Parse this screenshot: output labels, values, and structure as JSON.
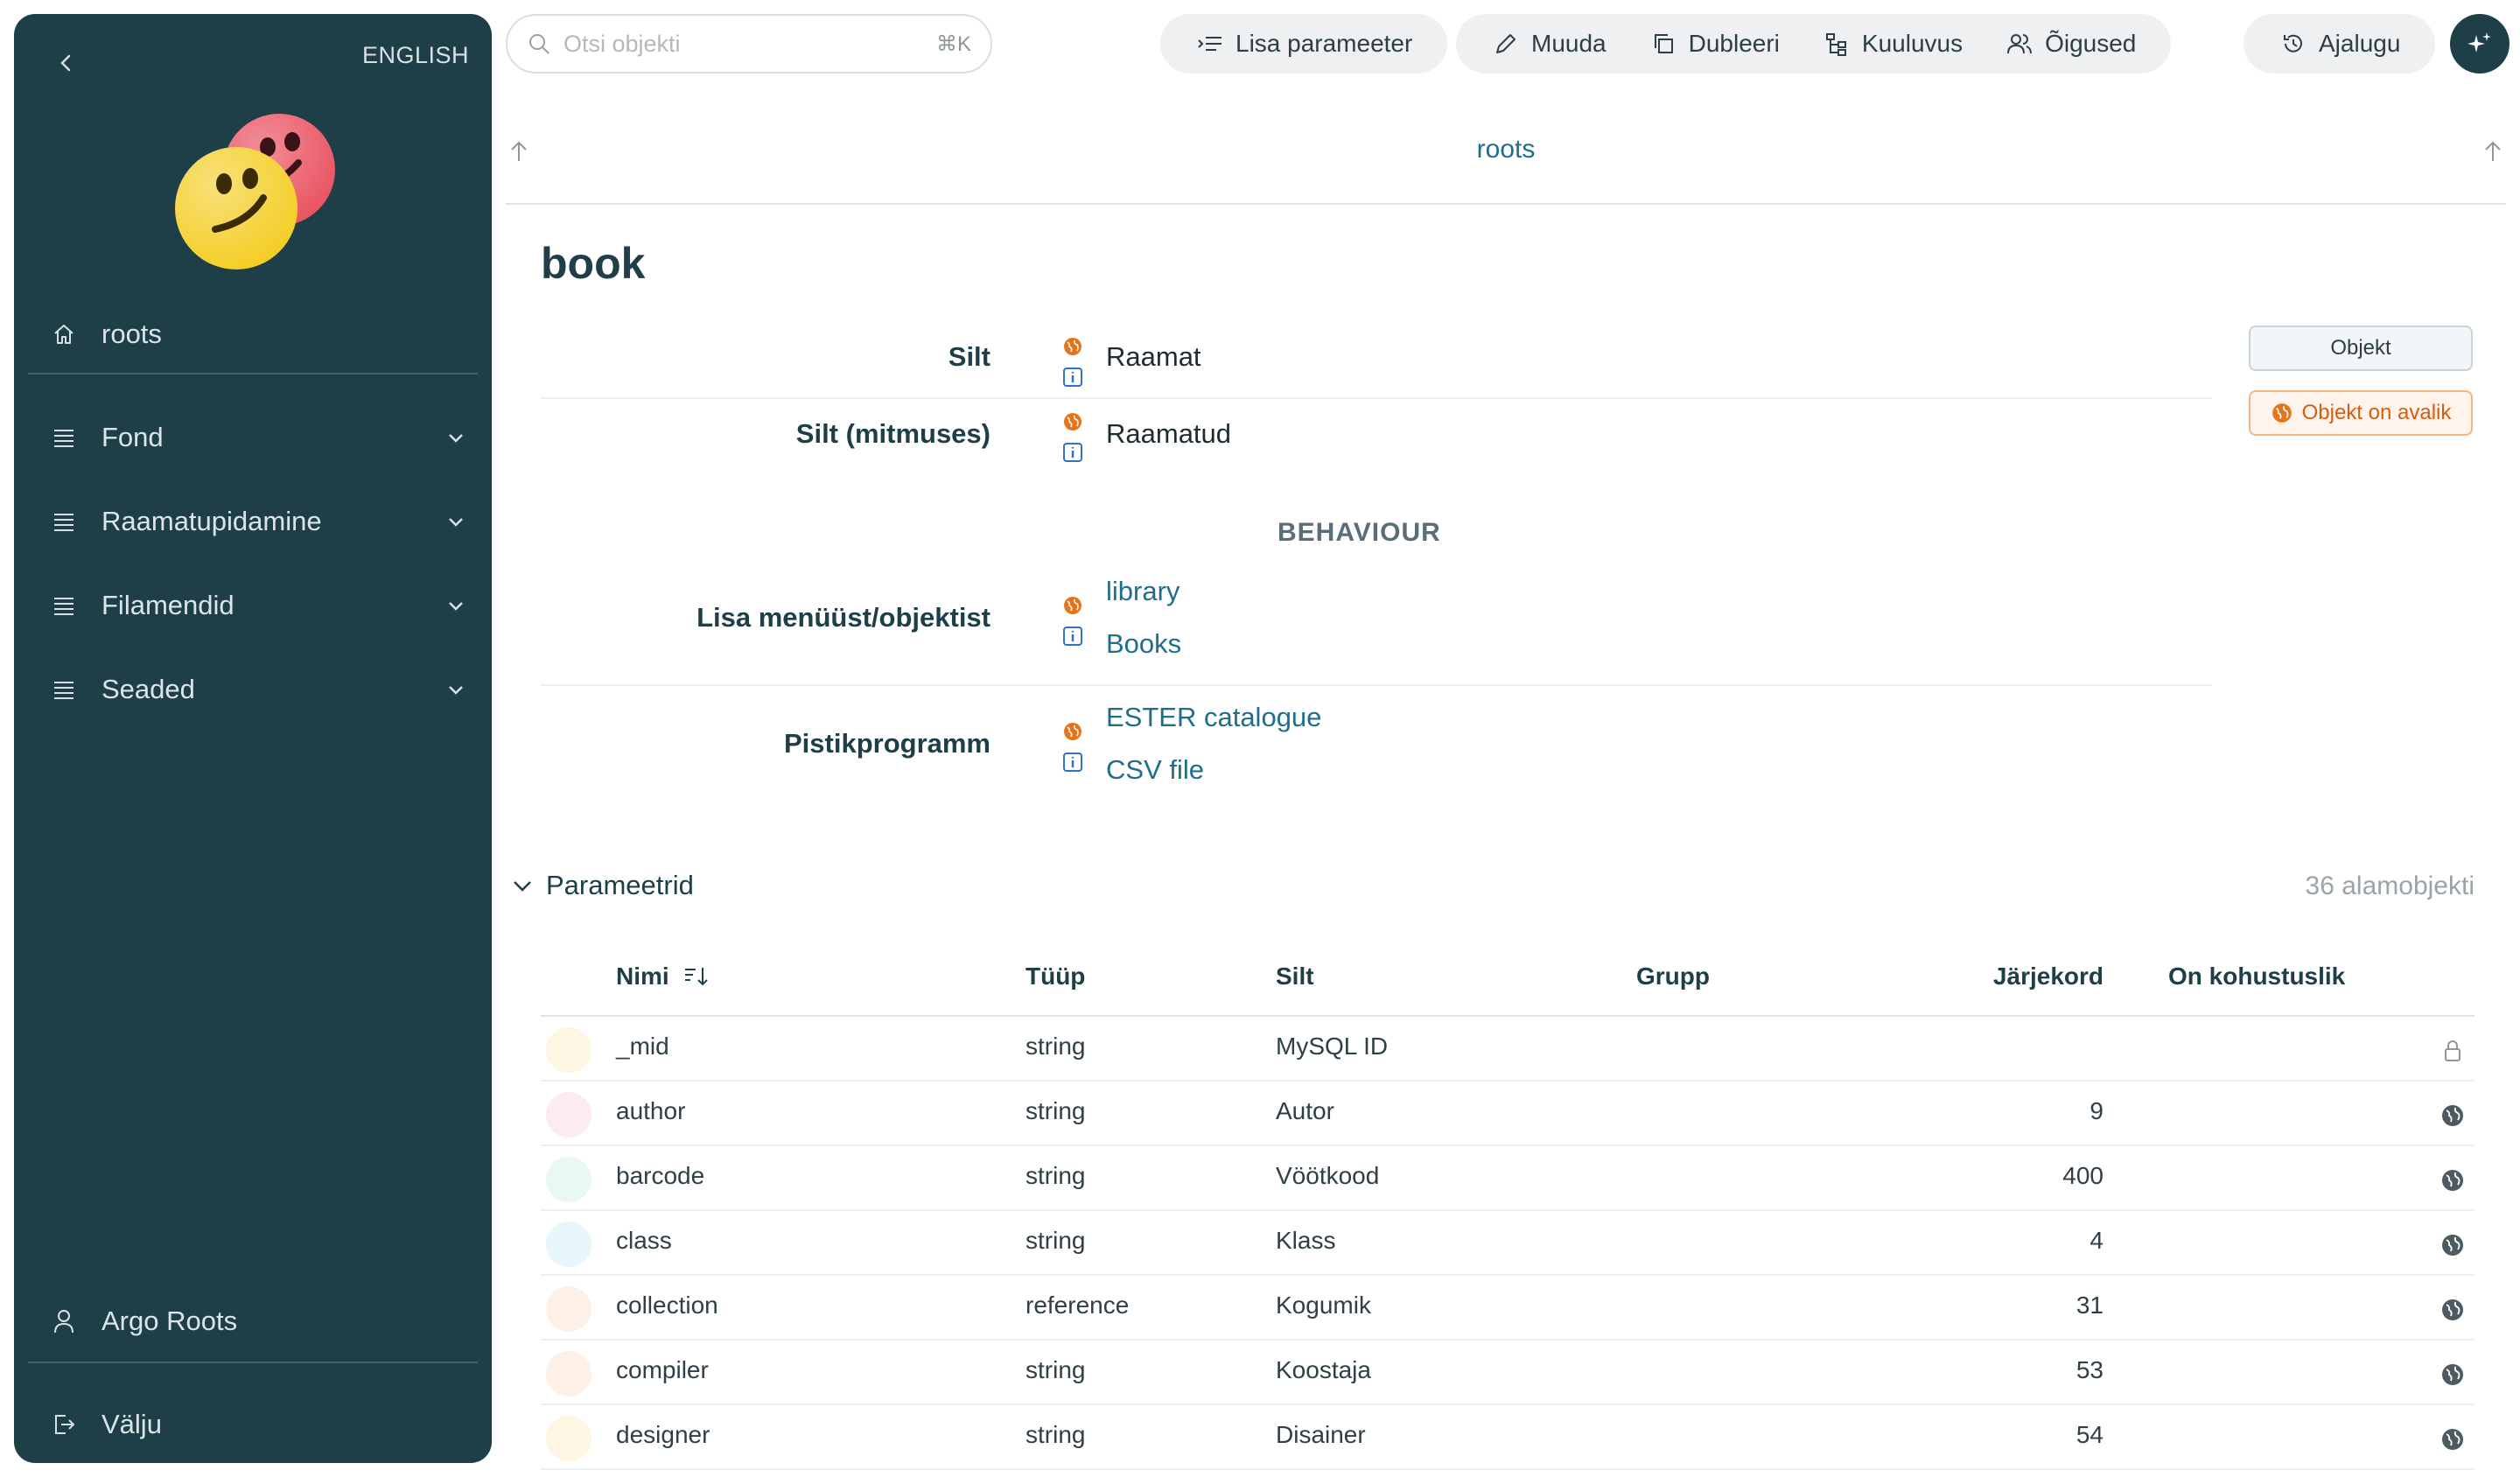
{
  "sidebar": {
    "language": "ENGLISH",
    "home_label": "roots",
    "nav": [
      {
        "label": "Fond"
      },
      {
        "label": "Raamatupidamine"
      },
      {
        "label": "Filamendid"
      },
      {
        "label": "Seaded"
      }
    ],
    "user_name": "Argo Roots",
    "logout_label": "Välju"
  },
  "toolbar": {
    "search_placeholder": "Otsi objekti",
    "search_shortcut": "⌘K",
    "add_parameter": "Lisa parameeter",
    "edit": "Muuda",
    "duplicate": "Dubleeri",
    "belonging": "Kuuluvus",
    "rights": "Õigused",
    "history": "Ajalugu"
  },
  "breadcrumb": "roots",
  "entity": {
    "title": "book",
    "properties": {
      "label": {
        "name": "Silt",
        "value": "Raamat"
      },
      "label_plural": {
        "name": "Silt (mitmuses)",
        "value": "Raamatud"
      },
      "section": "BEHAVIOUR",
      "add_from": {
        "name": "Lisa menüüst/objektist",
        "values": [
          "library",
          "Books"
        ]
      },
      "plugin": {
        "name": "Pistikprogramm",
        "values": [
          "ESTER catalogue",
          "CSV file"
        ]
      }
    },
    "badges": {
      "object": "Objekt",
      "public": "Objekt on avalik"
    }
  },
  "parameters": {
    "heading": "Parameetrid",
    "count": "36 alamobjekti",
    "columns": [
      "Nimi",
      "Tüüp",
      "Silt",
      "Grupp",
      "Järjekord",
      "On kohustuslik"
    ],
    "rows": [
      {
        "name": "_mid",
        "type": "string",
        "label": "MySQL ID",
        "group": "",
        "order": "",
        "color": "#fdf6e3",
        "icon": "lock-icon"
      },
      {
        "name": "author",
        "type": "string",
        "label": "Autor",
        "group": "",
        "order": "9",
        "color": "#fcecef",
        "icon": "globe-icon"
      },
      {
        "name": "barcode",
        "type": "string",
        "label": "Vöötkood",
        "group": "",
        "order": "400",
        "color": "#eaf8f4",
        "icon": "globe-icon"
      },
      {
        "name": "class",
        "type": "string",
        "label": "Klass",
        "group": "",
        "order": "4",
        "color": "#e6f6fb",
        "icon": "globe-icon"
      },
      {
        "name": "collection",
        "type": "reference",
        "label": "Kogumik",
        "group": "",
        "order": "31",
        "color": "#fdf0e6",
        "icon": "globe-icon"
      },
      {
        "name": "compiler",
        "type": "string",
        "label": "Koostaja",
        "group": "",
        "order": "53",
        "color": "#fdf0e6",
        "icon": "globe-icon"
      },
      {
        "name": "designer",
        "type": "string",
        "label": "Disainer",
        "group": "",
        "order": "54",
        "color": "#fdf6e3",
        "icon": "globe-icon"
      }
    ]
  },
  "colors": {
    "sidebar": "#1e3e48",
    "link": "#1f6e8c",
    "accent": "#e8741a"
  }
}
